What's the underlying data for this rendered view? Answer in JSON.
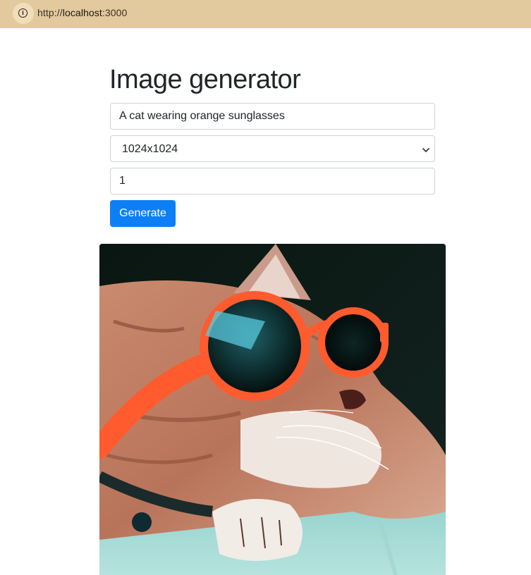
{
  "browser": {
    "url_prefix": "http://",
    "url_host": "localhost",
    "url_suffix": ":3000"
  },
  "page": {
    "title": "Image generator",
    "prompt": {
      "value": "A cat wearing orange sunglasses"
    },
    "size_select": {
      "selected": "1024x1024"
    },
    "count": {
      "value": "1"
    },
    "generate_label": "Generate"
  },
  "image": {
    "subject": "cat wearing orange sunglasses",
    "icon": "generated-image"
  },
  "colors": {
    "accent": "#0d7ff5",
    "addr_bar": "#e2c99e",
    "text": "#212529",
    "border": "#ced4da"
  }
}
